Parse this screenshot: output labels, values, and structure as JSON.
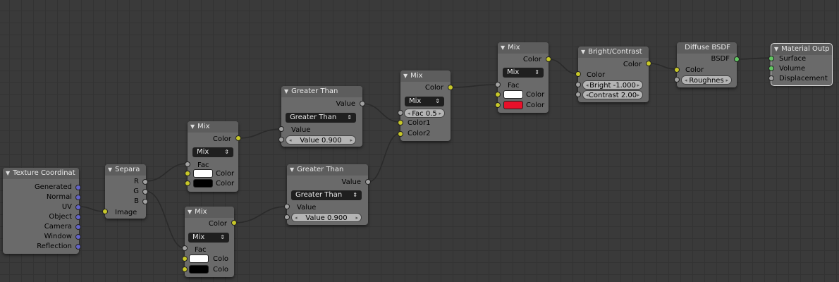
{
  "colors": {
    "wire": "#2a2a2a",
    "socket_color": "#c7c729",
    "socket_value": "#a1a1a1",
    "socket_vector": "#6363c7",
    "socket_shader": "#63c763",
    "swatch_white": "#ffffff",
    "swatch_black": "#000000",
    "swatch_red": "#e8102a"
  },
  "texcoord": {
    "title": "Texture Coordinat",
    "outputs": [
      "Generated",
      "Normal",
      "UV",
      "Object",
      "Camera",
      "Window",
      "Reflection"
    ]
  },
  "separate": {
    "title": "Separa",
    "out_r": "R",
    "out_g": "G",
    "out_b": "B",
    "in_image": "Image"
  },
  "mix_a": {
    "title": "Mix",
    "out": "Color",
    "blend": "Mix",
    "fac": "Fac",
    "color1": "Color",
    "color2": "Color"
  },
  "mix_b": {
    "title": "Mix",
    "out": "Color",
    "blend": "Mix",
    "fac": "Fac",
    "color1": "Colo",
    "color2": "Colo"
  },
  "gt_a": {
    "title": "Greater Than",
    "out": "Value",
    "op": "Greater Than",
    "in_value": "Value",
    "field": "Value 0.900"
  },
  "gt_b": {
    "title": "Greater Than",
    "out": "Value",
    "op": "Greater Than",
    "in_value": "Value",
    "field": "Value 0.900"
  },
  "mix_c": {
    "title": "Mix",
    "out": "Color",
    "blend": "Mix",
    "fac": "Fac 0.5",
    "color1": "Color1",
    "color2": "Color2"
  },
  "mix_d": {
    "title": "Mix",
    "out": "Color",
    "blend": "Mix",
    "fac": "Fac",
    "color1": "Color",
    "color2": "Color"
  },
  "bc": {
    "title": "Bright/Contrast",
    "out": "Color",
    "in_color": "Color",
    "bright": "Bright -1.000",
    "contrast": "Contrast 2.00"
  },
  "diffuse": {
    "title": "Diffuse BSDF",
    "out": "BSDF",
    "in_color": "Color",
    "roughness": "Roughnes"
  },
  "matout": {
    "title": "Material Outp",
    "surface": "Surface",
    "volume": "Volume",
    "displacement": "Displacement"
  }
}
